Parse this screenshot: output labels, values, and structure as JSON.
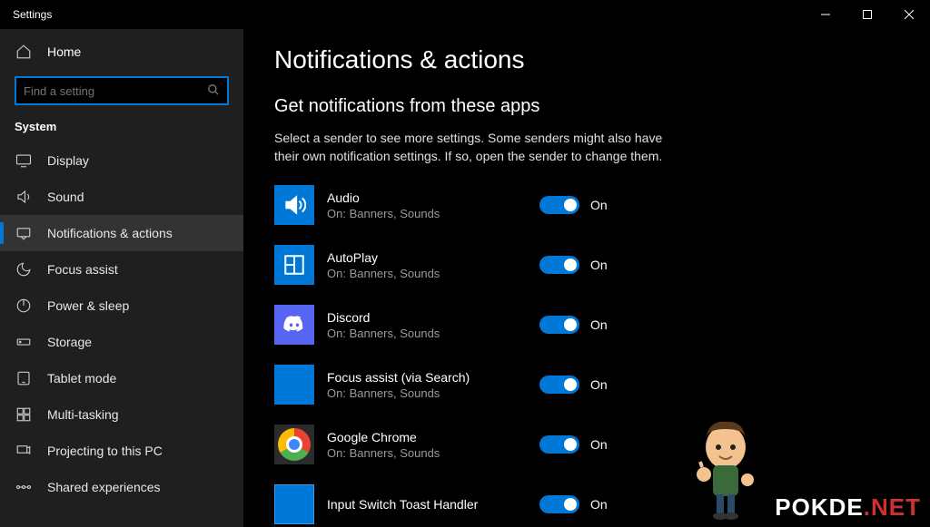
{
  "titlebar": {
    "title": "Settings"
  },
  "sidebar": {
    "home_label": "Home",
    "search_placeholder": "Find a setting",
    "section_label": "System",
    "items": [
      {
        "icon": "display",
        "label": "Display"
      },
      {
        "icon": "sound",
        "label": "Sound"
      },
      {
        "icon": "notifications",
        "label": "Notifications & actions",
        "active": true
      },
      {
        "icon": "moon",
        "label": "Focus assist"
      },
      {
        "icon": "power",
        "label": "Power & sleep"
      },
      {
        "icon": "storage",
        "label": "Storage"
      },
      {
        "icon": "tablet",
        "label": "Tablet mode"
      },
      {
        "icon": "multitask",
        "label": "Multi-tasking"
      },
      {
        "icon": "project",
        "label": "Projecting to this PC"
      },
      {
        "icon": "share",
        "label": "Shared experiences"
      }
    ]
  },
  "main": {
    "title": "Notifications & actions",
    "section_title": "Get notifications from these apps",
    "section_desc": "Select a sender to see more settings. Some senders might also have their own notification settings. If so, open the sender to change them.",
    "apps": [
      {
        "name": "Audio",
        "sub": "On: Banners, Sounds",
        "state": "On",
        "icon": "speaker"
      },
      {
        "name": "AutoPlay",
        "sub": "On: Banners, Sounds",
        "state": "On",
        "icon": "autoplay"
      },
      {
        "name": "Discord",
        "sub": "On: Banners, Sounds",
        "state": "On",
        "icon": "discord"
      },
      {
        "name": "Focus assist (via Search)",
        "sub": "On: Banners, Sounds",
        "state": "On",
        "icon": "blank"
      },
      {
        "name": "Google Chrome",
        "sub": "On: Banners, Sounds",
        "state": "On",
        "icon": "chrome"
      },
      {
        "name": "Input Switch Toast Handler",
        "sub": "",
        "state": "On",
        "icon": "blankblue"
      }
    ]
  },
  "watermark": {
    "text": "POKDE",
    "suffix": ".NET"
  }
}
